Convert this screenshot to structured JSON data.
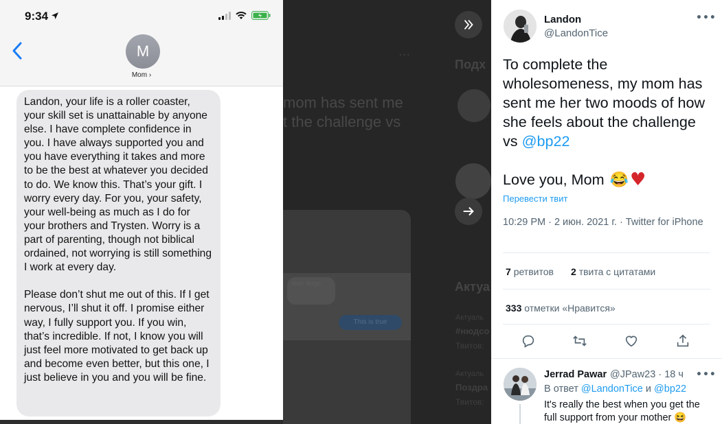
{
  "phone": {
    "time": "9:34",
    "contact_initial": "M",
    "contact_name": "Mom ›",
    "message": "Landon, your life is a roller coaster, your skill set is unattainable by anyone else.  I have complete confidence in you. I have always supported you and you have everything it takes and more to be the best at whatever you decided to do. We know this.  That’s your gift.  I worry every day.  For you, your safety, your well-being as much as I do for your brothers and Trysten. Worry is a part of parenting, though not biblical ordained, not worrying is still something I work at every day.\n\nPlease don’t shut me out of this. If I get nervous, I’ll shut it off.  I promise either way, I fully support you. If you win, that’s incredible.  If not, I know you will just feel more motivated to get back up and become even better, but this one, I just believe in you and you will be fine."
  },
  "background": {
    "tweet_text": "mom has sent me\nt the challenge vs",
    "bubble_gray": "awe doge",
    "bubble_blue": "This is true",
    "side_title": "Подх",
    "trends_title": "Актуа",
    "trend_1": "Актуаль",
    "trend_2": "#нюдсо",
    "trend_3": "Твитов:",
    "trend_4": "Актуаль",
    "trend_5": "Поздра",
    "trend_6": "Твитов:"
  },
  "tweet": {
    "author_name": "Landon",
    "author_handle": "@LandonTice",
    "text_before": "To complete the wholesomeness, my mom has sent me her two moods of how she feels about the challenge vs ",
    "mention": "@bp22",
    "text_love": "Love you, Mom",
    "emoji_laugh": "😂",
    "emoji_heart": "♥",
    "translate": "Перевести твит",
    "meta": "10:29 PM · 2 июн. 2021 г. · Twitter for iPhone",
    "retweets_count": "7",
    "retweets_label": "ретвитов",
    "quotes_count": "2",
    "quotes_label": "твита с цитатами",
    "likes_count": "333",
    "likes_label": "отметки «Нравится»"
  },
  "reply": {
    "name": "Jerrad Pawar",
    "handle": "@JPaw23 · 18 ч",
    "reply_prefix": "В ответ",
    "reply_mention_1": "@LandonTice",
    "reply_and": "и",
    "reply_mention_2": "@bp22",
    "text": "It's really the best when you get the full support from your mother 😆"
  },
  "icons": [
    "location-arrow-icon",
    "signal-icon",
    "wifi-icon",
    "battery-icon",
    "back-chevron-icon",
    "collapse-icon",
    "next-arrow-icon",
    "reply-icon",
    "retweet-icon",
    "like-icon",
    "share-icon",
    "more-icon"
  ]
}
